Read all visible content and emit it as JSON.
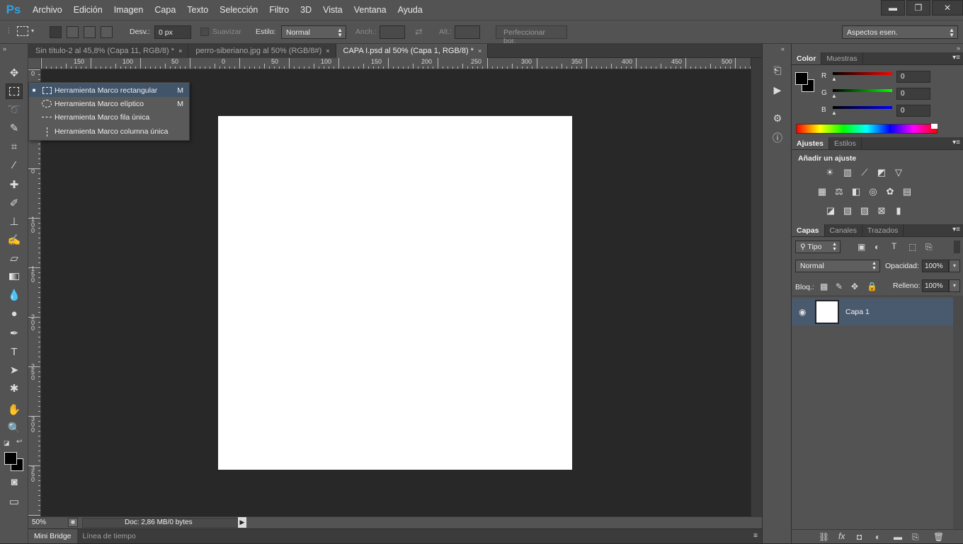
{
  "app": {
    "logo": "Ps"
  },
  "menu": [
    "Archivo",
    "Edición",
    "Imagen",
    "Capa",
    "Texto",
    "Selección",
    "Filtro",
    "3D",
    "Vista",
    "Ventana",
    "Ayuda"
  ],
  "window_controls": {
    "minimize": "▬",
    "restore": "❐",
    "close": "✕"
  },
  "options": {
    "feather_label": "Desv.:",
    "feather_value": "0 px",
    "antialias_label": "Suavizar",
    "style_label": "Estilo:",
    "style_value": "Normal",
    "width_label": "Anch.:",
    "height_label": "Alt.:",
    "refine_button": "Perfeccionar bor.",
    "workspace": "Aspectos esen."
  },
  "tabs": [
    {
      "label": "Sin título-2 al 45,8% (Capa 11, RGB/8) *",
      "close": "×"
    },
    {
      "label": "perro-siberiano.jpg al 50% (RGB/8#)",
      "close": "×"
    },
    {
      "label": "CAPA I.psd al 50% (Capa 1, RGB/8) *",
      "close": "×"
    }
  ],
  "ruler_h_labels": [
    "150",
    "100",
    "50",
    "0",
    "50",
    "100",
    "150",
    "200",
    "250",
    "300",
    "350",
    "400",
    "450",
    "500"
  ],
  "ruler_v_labels": [
    "0",
    "5",
    "0",
    "1\n0\n0",
    "1\n5\n0",
    "2\n0\n0",
    "2\n5\n0",
    "3\n0\n0",
    "3\n5\n0"
  ],
  "flyout": [
    {
      "label": "Herramienta Marco rectangular",
      "key": "M",
      "selected": true,
      "bullet": "■"
    },
    {
      "label": "Herramienta Marco elíptico",
      "key": "M",
      "selected": false,
      "bullet": ""
    },
    {
      "label": "Herramienta Marco fila única",
      "key": "",
      "selected": false,
      "bullet": ""
    },
    {
      "label": "Herramienta Marco columna única",
      "key": "",
      "selected": false,
      "bullet": ""
    }
  ],
  "status": {
    "zoom": "50%",
    "doc": "Doc: 2,86 MB/0 bytes"
  },
  "bottom_tabs": [
    "Mini Bridge",
    "Línea de tiempo"
  ],
  "color_panel": {
    "tabs": [
      "Color",
      "Muestras"
    ],
    "channels": [
      {
        "label": "R",
        "value": "0",
        "gradient_color": "#ff0000"
      },
      {
        "label": "G",
        "value": "0",
        "gradient_color": "#00ff00"
      },
      {
        "label": "B",
        "value": "0",
        "gradient_color": "#0000ff"
      }
    ]
  },
  "adjustments_panel": {
    "tabs": [
      "Ajustes",
      "Estilos"
    ],
    "title": "Añadir un ajuste"
  },
  "layers_panel": {
    "tabs": [
      "Capas",
      "Canales",
      "Trazados"
    ],
    "filter": "Tipo",
    "blend_mode": "Normal",
    "opacity_label": "Opacidad:",
    "opacity_value": "100%",
    "lock_label": "Bloq.:",
    "fill_label": "Relleno:",
    "fill_value": "100%",
    "layers": [
      {
        "name": "Capa 1",
        "visible": true
      }
    ]
  },
  "colors": {
    "ui_bg": "#535353",
    "canvas_bg": "#282828",
    "selection": "#4a5a6e",
    "ps_blue": "#2fa3e6"
  }
}
